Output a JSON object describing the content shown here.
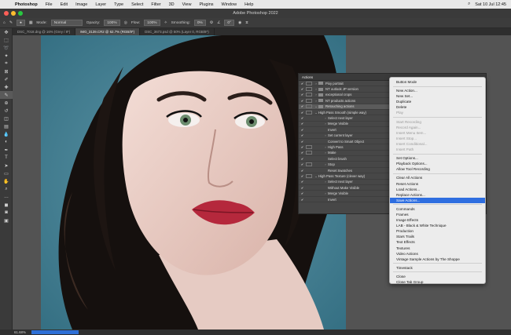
{
  "menubar": {
    "app": "Photoshop",
    "items": [
      "File",
      "Edit",
      "Image",
      "Layer",
      "Type",
      "Select",
      "Filter",
      "3D",
      "View",
      "Plugins",
      "Window",
      "Help"
    ],
    "clock": "Sat 10 Jul 12:45"
  },
  "window_title": "Adobe Photoshop 2022",
  "options": {
    "mode_label": "Mode:",
    "mode_value": "Normal",
    "opacity_label": "Opacity:",
    "opacity_value": "100%",
    "flow_label": "Flow:",
    "flow_value": "100%",
    "smoothing_label": "Smoothing:",
    "smoothing_value": "0%",
    "angle_value": "0°"
  },
  "tabs": [
    {
      "label": "DSC_7018.dng @ 16% (Grey / 8*)"
    },
    {
      "label": "IMG_3139.CR2 @ 62.7% (RGB/8*)"
    },
    {
      "label": "DSC_3673.psd @ 50% (Layer 0, RGB/8*)"
    }
  ],
  "tools": [
    "move",
    "marquee",
    "lasso",
    "wand",
    "crop",
    "frame",
    "eyedropper",
    "heal",
    "brush",
    "stamp",
    "history",
    "eraser",
    "gradient",
    "blur",
    "dodge",
    "pen",
    "type",
    "path",
    "shape",
    "hand",
    "zoom",
    "more",
    "fgbg",
    "quickmask",
    "screen"
  ],
  "status": {
    "zoom": "61.68%"
  },
  "actions_panel": {
    "tab": "Actions",
    "rows": [
      {
        "check": "✔",
        "dialog": true,
        "tri": "›",
        "folder": true,
        "label": "Pixy portrait"
      },
      {
        "check": "✔",
        "dialog": true,
        "tri": "›",
        "folder": true,
        "label": "NT outlook JP version"
      },
      {
        "check": "✔",
        "dialog": true,
        "tri": "›",
        "folder": true,
        "label": "exceptional crops"
      },
      {
        "check": "✔",
        "dialog": true,
        "tri": "›",
        "folder": true,
        "label": "NT products actions"
      },
      {
        "check": "✔",
        "dialog": true,
        "tri": "⌄",
        "folder": true,
        "label": "Retouching actions",
        "hl": true
      },
      {
        "check": "✔",
        "dialog": true,
        "tri": "⌄",
        "folder": false,
        "label": "High Pass Smooth (simple way)"
      },
      {
        "check": "✔",
        "dialog": false,
        "tri": "›",
        "folder": false,
        "label": "Select next layer",
        "indent": 2
      },
      {
        "check": "✔",
        "dialog": false,
        "tri": "›",
        "folder": false,
        "label": "Merge Visible",
        "indent": 2
      },
      {
        "check": "✔",
        "dialog": false,
        "tri": "",
        "folder": false,
        "label": "Invert",
        "indent": 2
      },
      {
        "check": "✔",
        "dialog": false,
        "tri": "›",
        "folder": false,
        "label": "Set current layer",
        "indent": 2
      },
      {
        "check": "✔",
        "dialog": false,
        "tri": "",
        "folder": false,
        "label": "Convert to Smart Object",
        "indent": 2
      },
      {
        "check": "✔",
        "dialog": true,
        "tri": "›",
        "folder": false,
        "label": "High Pass",
        "indent": 2
      },
      {
        "check": "✔",
        "dialog": true,
        "tri": "›",
        "folder": false,
        "label": "Make",
        "indent": 2
      },
      {
        "check": "✔",
        "dialog": false,
        "tri": "",
        "folder": false,
        "label": "Select brush",
        "indent": 2
      },
      {
        "check": "✔",
        "dialog": true,
        "tri": "›",
        "folder": false,
        "label": "Stop",
        "indent": 2
      },
      {
        "check": "✔",
        "dialog": false,
        "tri": "",
        "folder": false,
        "label": "Reset Swatches",
        "indent": 2
      },
      {
        "check": "✔",
        "dialog": true,
        "tri": "⌄",
        "folder": false,
        "label": "High Pass Texture (clever way)"
      },
      {
        "check": "✔",
        "dialog": false,
        "tri": "›",
        "folder": false,
        "label": "Select next layer",
        "indent": 2
      },
      {
        "check": "✔",
        "dialog": false,
        "tri": "",
        "folder": false,
        "label": "Without Make Visible",
        "indent": 2
      },
      {
        "check": "✔",
        "dialog": false,
        "tri": "›",
        "folder": false,
        "label": "Merge Visible",
        "indent": 2
      },
      {
        "check": "✔",
        "dialog": false,
        "tri": "",
        "folder": false,
        "label": "Invert",
        "indent": 2
      }
    ]
  },
  "flyout_menu": [
    {
      "label": "Button Mode"
    },
    {
      "sep": true
    },
    {
      "label": "New Action..."
    },
    {
      "label": "New Set..."
    },
    {
      "label": "Duplicate"
    },
    {
      "label": "Delete"
    },
    {
      "label": "Play",
      "disabled": true
    },
    {
      "sep": true
    },
    {
      "label": "Start Recording",
      "disabled": true
    },
    {
      "label": "Record Again...",
      "disabled": true
    },
    {
      "label": "Insert Menu Item...",
      "disabled": true
    },
    {
      "label": "Insert Stop...",
      "disabled": true
    },
    {
      "label": "Insert Conditional...",
      "disabled": true
    },
    {
      "label": "Insert Path",
      "disabled": true
    },
    {
      "sep": true
    },
    {
      "label": "Set Options..."
    },
    {
      "label": "Playback Options..."
    },
    {
      "label": "Allow Tool Recording"
    },
    {
      "sep": true
    },
    {
      "label": "Clear All Actions"
    },
    {
      "label": "Reset Actions"
    },
    {
      "label": "Load Actions..."
    },
    {
      "label": "Replace Actions..."
    },
    {
      "label": "Save Actions...",
      "selected": true
    },
    {
      "sep": true
    },
    {
      "label": "Commands"
    },
    {
      "label": "Frames"
    },
    {
      "label": "Image Effects"
    },
    {
      "label": "LAB - Black & White Technique"
    },
    {
      "label": "Production"
    },
    {
      "label": "Stars Trails"
    },
    {
      "label": "Text Effects"
    },
    {
      "label": "Textures"
    },
    {
      "label": "Video Actions"
    },
    {
      "label": "Vintage Sample Actions by The Shoppe"
    },
    {
      "sep": true
    },
    {
      "label": "Timestack"
    },
    {
      "sep": true
    },
    {
      "label": "Close"
    },
    {
      "label": "Close Tab Group"
    }
  ],
  "colors": {
    "accent": "#2e6ee0",
    "ui_dark": "#3a3a3a",
    "backdrop": "#3f7a8e"
  }
}
